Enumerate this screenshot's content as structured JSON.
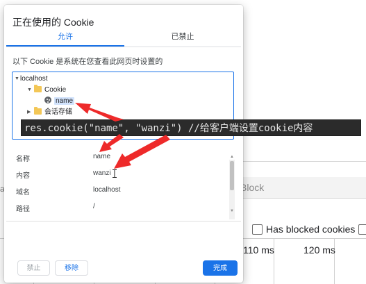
{
  "background": {
    "block_text": "Block",
    "blocked_cookies_label": "Has blocked cookies",
    "timeline_labels": [
      "110 ms",
      "120 ms"
    ],
    "left_fragment": "a"
  },
  "dialog": {
    "title": "正在使用的 Cookie",
    "tabs": [
      {
        "label": "允许",
        "active": true
      },
      {
        "label": "已禁止",
        "active": false
      }
    ],
    "description": "以下 Cookie 是系统在您查看此网页时设置的",
    "tree": {
      "root": "localhost",
      "folder": "Cookie",
      "cookie_name": "name",
      "storage": "会话存储"
    },
    "details": [
      {
        "label": "名称",
        "value": "name"
      },
      {
        "label": "内容",
        "value": "wanzi"
      },
      {
        "label": "域名",
        "value": "localhost"
      },
      {
        "label": "路径",
        "value": "/"
      }
    ],
    "buttons": {
      "block": "禁止",
      "remove": "移除",
      "done": "完成"
    }
  },
  "annotation": {
    "code": "res.cookie(\"name\", \"wanzi\") //给客户端设置cookie内容"
  },
  "colors": {
    "accent": "#1a73e8",
    "arrow": "#ee2a2a",
    "code_bg": "#2b2b2b",
    "folder": "#f3c757",
    "selection": "#d2e3fc"
  }
}
